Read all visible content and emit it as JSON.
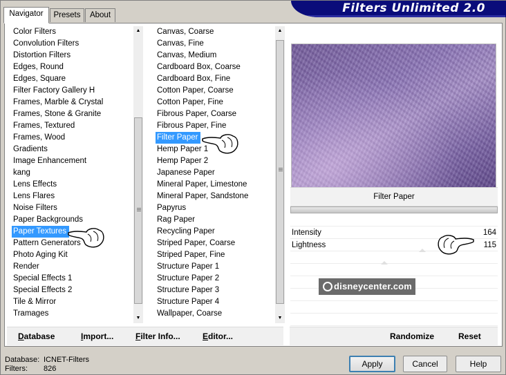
{
  "banner": {
    "title": "Filters Unlimited 2.0"
  },
  "tabs": [
    {
      "label": "Navigator"
    },
    {
      "label": "Presets"
    },
    {
      "label": "About"
    }
  ],
  "categories": [
    "Color Filters",
    "Convolution Filters",
    "Distortion Filters",
    "Edges, Round",
    "Edges, Square",
    "Filter Factory Gallery H",
    "Frames, Marble & Crystal",
    "Frames, Stone & Granite",
    "Frames, Textured",
    "Frames, Wood",
    "Gradients",
    "Image Enhancement",
    "kang",
    "Lens Effects",
    "Lens Flares",
    "Noise Filters",
    "Paper Backgrounds",
    "Paper Textures",
    "Pattern Generators",
    "Photo Aging Kit",
    "Render",
    "Special Effects 1",
    "Special Effects 2",
    "Tile & Mirror",
    "Tramages"
  ],
  "filters": [
    "Canvas, Coarse",
    "Canvas, Fine",
    "Canvas, Medium",
    "Cardboard Box, Coarse",
    "Cardboard Box, Fine",
    "Cotton Paper, Coarse",
    "Cotton Paper, Fine",
    "Fibrous Paper, Coarse",
    "Fibrous Paper, Fine",
    "Filter Paper",
    "Hemp Paper 1",
    "Hemp Paper 2",
    "Japanese Paper",
    "Mineral Paper, Limestone",
    "Mineral Paper, Sandstone",
    "Papyrus",
    "Rag Paper",
    "Recycling Paper",
    "Striped Paper, Coarse",
    "Striped Paper, Fine",
    "Structure Paper 1",
    "Structure Paper 2",
    "Structure Paper 3",
    "Structure Paper 4",
    "Wallpaper, Coarse"
  ],
  "selected_category": "Paper Textures",
  "selected_filter": "Filter Paper",
  "filter_name": "Filter Paper",
  "params": [
    {
      "label": "Intensity",
      "value": "164"
    },
    {
      "label": "Lightness",
      "value": "115"
    }
  ],
  "watermark": "disneycenter.com",
  "toolbar_left": [
    {
      "label": "Database",
      "ul": "D",
      "rest": "atabase"
    },
    {
      "label": "Import...",
      "ul": "I",
      "rest": "mport..."
    },
    {
      "label": "Filter Info...",
      "ul": "F",
      "rest": "ilter Info..."
    },
    {
      "label": "Editor...",
      "ul": "E",
      "rest": "ditor..."
    }
  ],
  "toolbar_right": [
    {
      "label": "Randomize"
    },
    {
      "label": "Reset"
    }
  ],
  "status": {
    "database_label": "Database:",
    "database_value": "ICNET-Filters",
    "filters_label": "Filters:",
    "filters_value": "826"
  },
  "buttons": {
    "apply": "Apply",
    "cancel": "Cancel",
    "help": "Help"
  },
  "colors": {
    "banner": "#0a0c7a",
    "selection": "#3399ff",
    "preview": "#8d77b8"
  },
  "icons": {
    "pointer": "mickey-glove-pointer-icon",
    "scroll_up": "scroll-up-arrow-icon",
    "scroll_down": "scroll-down-arrow-icon"
  }
}
